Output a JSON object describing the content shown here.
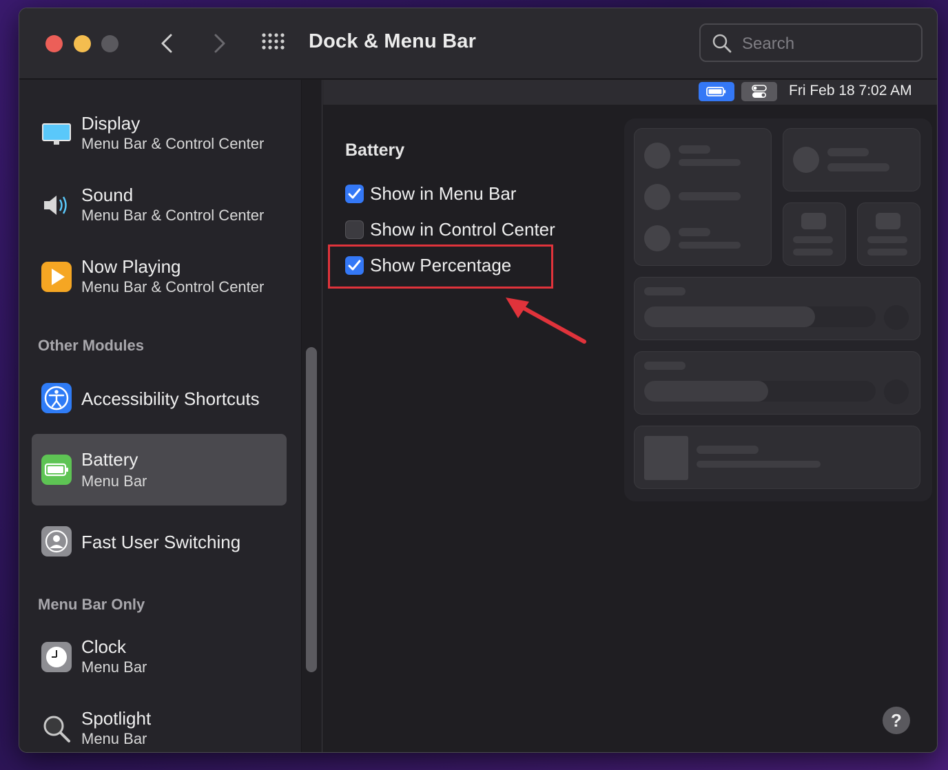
{
  "window": {
    "title": "Dock & Menu Bar",
    "search_placeholder": "Search"
  },
  "sidebar": {
    "items": [
      {
        "title": "Display",
        "subtitle": "Menu Bar & Control Center",
        "icon": "display-icon"
      },
      {
        "title": "Sound",
        "subtitle": "Menu Bar & Control Center",
        "icon": "speaker-icon"
      },
      {
        "title": "Now Playing",
        "subtitle": "Menu Bar & Control Center",
        "icon": "play-icon"
      }
    ],
    "other_modules_header": "Other Modules",
    "other_modules": [
      {
        "title": "Accessibility Shortcuts",
        "icon": "accessibility-icon"
      },
      {
        "title": "Battery",
        "subtitle": "Menu Bar",
        "icon": "battery-icon",
        "selected": true
      },
      {
        "title": "Fast User Switching",
        "icon": "user-icon"
      }
    ],
    "menu_bar_only_header": "Menu Bar Only",
    "menu_bar_only": [
      {
        "title": "Clock",
        "subtitle": "Menu Bar",
        "icon": "clock-icon"
      },
      {
        "title": "Spotlight",
        "subtitle": "Menu Bar",
        "icon": "spotlight-icon"
      }
    ]
  },
  "menubar_preview": {
    "clock": "Fri Feb 18  7:02 AM"
  },
  "battery": {
    "section_title": "Battery",
    "options": [
      {
        "label": "Show in Menu Bar",
        "checked": true
      },
      {
        "label": "Show in Control Center",
        "checked": false
      },
      {
        "label": "Show Percentage",
        "checked": true
      }
    ]
  },
  "help_label": "?",
  "colors": {
    "accent": "#3478f6",
    "highlight": "#e0333b",
    "window_bg": "#1f1e22"
  }
}
